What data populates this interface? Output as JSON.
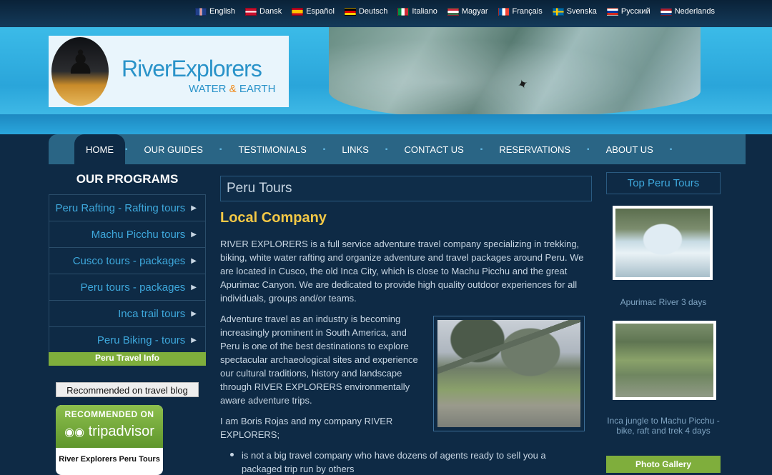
{
  "languages": [
    {
      "label": "English",
      "colors": [
        "#1f3f8a",
        "#cc2a2a"
      ]
    },
    {
      "label": "Dansk",
      "colors": [
        "#c8102e",
        "#ffffff"
      ]
    },
    {
      "label": "Español",
      "colors": [
        "#c60b1e",
        "#ffc400"
      ]
    },
    {
      "label": "Deutsch",
      "colors": [
        "#000000",
        "#dd0000"
      ]
    },
    {
      "label": "Italiano",
      "colors": [
        "#009246",
        "#ce2b37"
      ]
    },
    {
      "label": "Magyar",
      "colors": [
        "#cd2a3e",
        "#436f4d"
      ]
    },
    {
      "label": "Français",
      "colors": [
        "#0055a4",
        "#ef4135"
      ]
    },
    {
      "label": "Svenska",
      "colors": [
        "#006aa7",
        "#fecc00"
      ]
    },
    {
      "label": "Русский",
      "colors": [
        "#ffffff",
        "#d52b1e"
      ]
    },
    {
      "label": "Nederlands",
      "colors": [
        "#ae1c28",
        "#21468b"
      ]
    }
  ],
  "logo": {
    "title": "RiverExplorers",
    "sub_a": "WATER",
    "sub_amp": "&",
    "sub_b": "EARTH"
  },
  "nav": [
    "HOME",
    "OUR GUIDES",
    "TESTIMONIALS",
    "LINKS",
    "CONTACT US",
    "RESERVATIONS",
    "ABOUT US"
  ],
  "left": {
    "title": "OUR PROGRAMS",
    "programs": [
      "Peru Rafting - Rafting tours",
      "Machu Picchu tours",
      "Cusco tours - packages",
      "Peru tours - packages",
      "Inca trail tours",
      "Peru Biking - tours"
    ],
    "travel_info": "Peru Travel Info",
    "blog_button": "Recommended on travel blog",
    "tripadvisor": {
      "recommended": "RECOMMENDED ON",
      "brand": "tripadvisor",
      "name": "River Explorers Peru Tours"
    }
  },
  "main": {
    "page_title": "Peru Tours",
    "section_title": "Local Company",
    "p1": "RIVER EXPLORERS is a full service adventure travel company specializing in trekking, biking, white water rafting and organize adventure and travel packages around Peru. We are located in Cusco, the old Inca City, which is close to Machu Picchu and the great Apurimac Canyon. We are dedicated to provide high quality outdoor experiences for all individuals, groups and/or teams.",
    "p2": "Adventure travel as an industry is becoming increasingly prominent in South America, and Peru is one of the best destinations to explore spectacular archaeological sites and experience our cultural traditions, history and landscape through RIVER EXPLORERS environmentally aware adventure trips.",
    "p3": "I am Boris Rojas and my company RIVER EXPLORERS;",
    "bullet1": "is not a big travel company who have dozens of agents ready to sell you a packaged trip run by others"
  },
  "right": {
    "title": "Top Peru Tours",
    "tour1_caption": "Apurimac River 3 days",
    "tour2_caption": "Inca jungle to Machu Picchu - bike, raft and trek 4 days",
    "gallery_button": "Photo Gallery"
  }
}
